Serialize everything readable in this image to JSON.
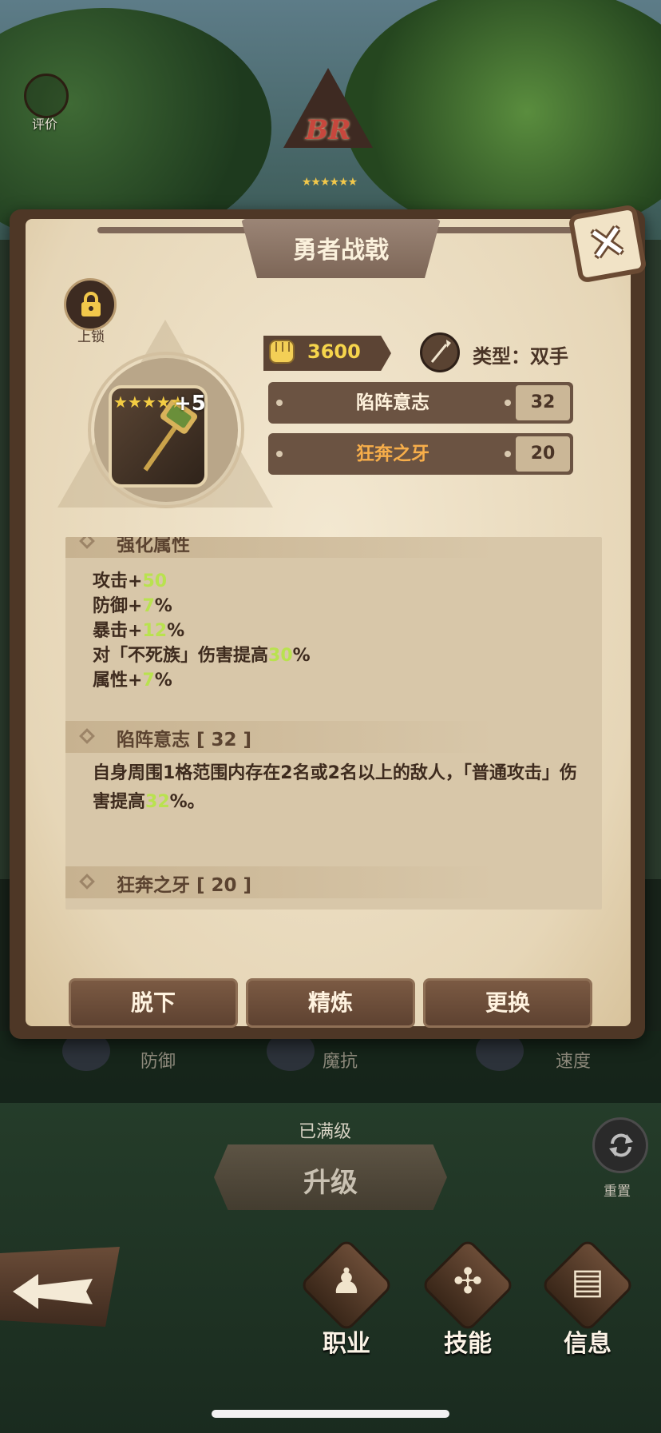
{
  "top": {
    "eval_label": "评价",
    "rank_text": "BR",
    "rank_stars": "★★★★★★"
  },
  "modal": {
    "title": "勇者战戟",
    "lock_label": "上锁",
    "item": {
      "plus": "+5",
      "stars": "★★★★★"
    },
    "power": "3600",
    "type_label": "类型：双手",
    "attrs": [
      {
        "name": "陷阵意志",
        "value": "32"
      },
      {
        "name": "狂奔之牙",
        "value": "20"
      }
    ],
    "sections": {
      "enhance_title": "强化属性",
      "enhance_lines": [
        {
          "prefix": "攻击+",
          "value": "50",
          "suffix": ""
        },
        {
          "prefix": "防御+",
          "value": "7",
          "suffix": "%"
        },
        {
          "prefix": "暴击+",
          "value": "12",
          "suffix": "%"
        },
        {
          "prefix": "对「不死族」伤害提高",
          "value": "30",
          "suffix": "%"
        },
        {
          "prefix": "属性+",
          "value": "7",
          "suffix": "%"
        }
      ],
      "skill1_title": "陷阵意志 [ 32 ]",
      "skill1_text_a": "自身周围1格范围内存在2名或2名以上的敌人，「普通攻击」伤害提高",
      "skill1_value": "32",
      "skill1_text_b": "%。",
      "skill2_title": "狂奔之牙 [ 20 ]"
    },
    "buttons": {
      "unequip": "脱下",
      "refine": "精炼",
      "replace": "更换"
    }
  },
  "background": {
    "stats": [
      "防御",
      "魔抗",
      "速度"
    ],
    "maxed": "已满级",
    "upgrade": "升级",
    "reset": "重置"
  },
  "nav": {
    "class": "职业",
    "skill": "技能",
    "info": "信息"
  },
  "colors": {
    "accent_green": "#b9e24f",
    "accent_orange": "#f7ae4a",
    "power_yellow": "#f6d54c"
  }
}
